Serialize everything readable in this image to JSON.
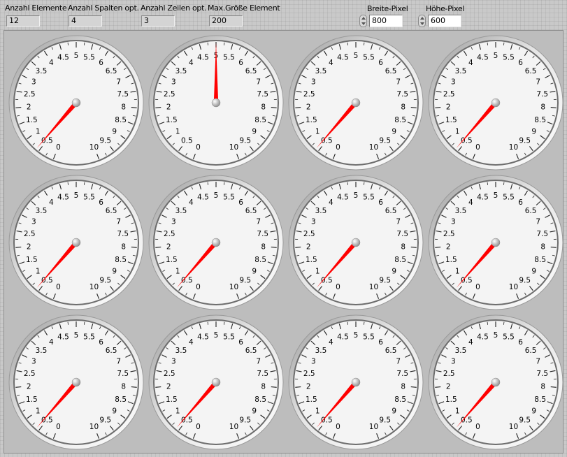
{
  "controls": {
    "anzahl_elemente": {
      "label": "Anzahl Elemente",
      "value": "12"
    },
    "anzahl_spalten": {
      "label": "Anzahl Spalten opt.",
      "value": "4"
    },
    "anzahl_zeilen": {
      "label": "Anzahl Zeilen opt.",
      "value": "3"
    },
    "max_groesse": {
      "label": "Max.Größe Element",
      "value": "200"
    },
    "breite_pixel": {
      "label": "Breite-Pixel",
      "value": "800"
    },
    "hoehe_pixel": {
      "label": "Höhe-Pixel",
      "value": "600"
    }
  },
  "gauge_scale": {
    "min": 0,
    "max": 10,
    "labels": [
      "0",
      "0.5",
      "1",
      "1.5",
      "2",
      "2.5",
      "3",
      "3.5",
      "4",
      "4.5",
      "5",
      "5.5",
      "6",
      "6.5",
      "7",
      "7.5",
      "8",
      "8.5",
      "9",
      "9.5",
      "10"
    ]
  },
  "gauges": [
    {
      "value": 0.6
    },
    {
      "value": 5.0
    },
    {
      "value": 0.6
    },
    {
      "value": 0.6
    },
    {
      "value": 0.6
    },
    {
      "value": 0.6
    },
    {
      "value": 0.6
    },
    {
      "value": 0.6
    },
    {
      "value": 0.6
    },
    {
      "value": 0.6
    },
    {
      "value": 0.6
    },
    {
      "value": 0.6
    }
  ],
  "colors": {
    "needle": "#ff0000",
    "dial_face": "#f4f4f4",
    "panel_bg": "#bdbdbd"
  }
}
